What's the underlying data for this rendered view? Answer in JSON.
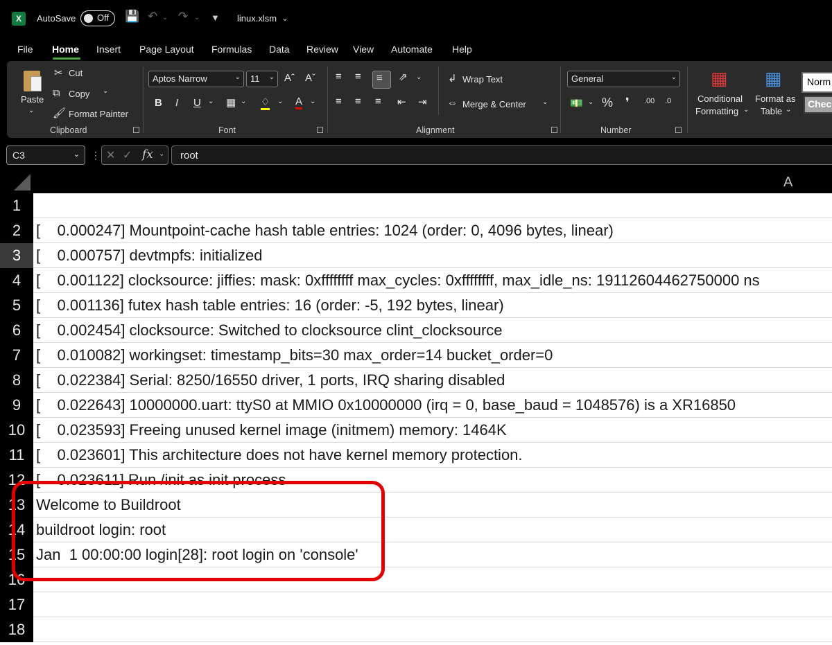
{
  "titlebar": {
    "autosave_label": "AutoSave",
    "autosave_state": "Off",
    "filename": "linux.xlsm"
  },
  "tabs": [
    "File",
    "Home",
    "Insert",
    "Page Layout",
    "Formulas",
    "Data",
    "Review",
    "View",
    "Automate",
    "Help"
  ],
  "active_tab": "Home",
  "ribbon": {
    "clipboard": {
      "paste": "Paste",
      "cut": "Cut",
      "copy": "Copy",
      "format_painter": "Format Painter",
      "group_label": "Clipboard"
    },
    "font": {
      "font_name": "Aptos Narrow",
      "font_size": "11",
      "group_label": "Font"
    },
    "alignment": {
      "wrap_text": "Wrap Text",
      "merge_center": "Merge & Center",
      "group_label": "Alignment"
    },
    "number": {
      "format": "General",
      "group_label": "Number"
    },
    "styles": {
      "conditional_formatting_1": "Conditional",
      "conditional_formatting_2": "Formatting",
      "format_as_table_1": "Format as",
      "format_as_table_2": "Table",
      "style_normal": "Norm",
      "style_check": "Chec"
    }
  },
  "formula_bar": {
    "name_box": "C3",
    "value": "root"
  },
  "sheet": {
    "column_header": "A",
    "selected_row": 3,
    "rows": [
      {
        "n": "1",
        "text": ""
      },
      {
        "n": "2",
        "text": "[    0.000247] Mountpoint-cache hash table entries: 1024 (order: 0, 4096 bytes, linear)"
      },
      {
        "n": "3",
        "text": "[    0.000757] devtmpfs: initialized"
      },
      {
        "n": "4",
        "text": "[    0.001122] clocksource: jiffies: mask: 0xffffffff max_cycles: 0xffffffff, max_idle_ns: 19112604462750000 ns"
      },
      {
        "n": "5",
        "text": "[    0.001136] futex hash table entries: 16 (order: -5, 192 bytes, linear)"
      },
      {
        "n": "6",
        "text": "[    0.002454] clocksource: Switched to clocksource clint_clocksource"
      },
      {
        "n": "7",
        "text": "[    0.010082] workingset: timestamp_bits=30 max_order=14 bucket_order=0"
      },
      {
        "n": "8",
        "text": "[    0.022384] Serial: 8250/16550 driver, 1 ports, IRQ sharing disabled"
      },
      {
        "n": "9",
        "text": "[    0.022643] 10000000.uart: ttyS0 at MMIO 0x10000000 (irq = 0, base_baud = 1048576) is a XR16850"
      },
      {
        "n": "10",
        "text": "[    0.023593] Freeing unused kernel image (initmem) memory: 1464K"
      },
      {
        "n": "11",
        "text": "[    0.023601] This architecture does not have kernel memory protection."
      },
      {
        "n": "12",
        "text": "[    0.023611] Run /init as init process"
      },
      {
        "n": "13",
        "text": "Welcome to Buildroot"
      },
      {
        "n": "14",
        "text": "buildroot login: root"
      },
      {
        "n": "15",
        "text": "Jan  1 00:00:00 login[28]: root login on 'console'"
      },
      {
        "n": "16",
        "text": ""
      },
      {
        "n": "17",
        "text": ""
      },
      {
        "n": "18",
        "text": ""
      }
    ]
  },
  "colors": {
    "highlight_box": "#e00000",
    "excel_green": "#107c41",
    "tab_underline": "#4ea63f"
  }
}
